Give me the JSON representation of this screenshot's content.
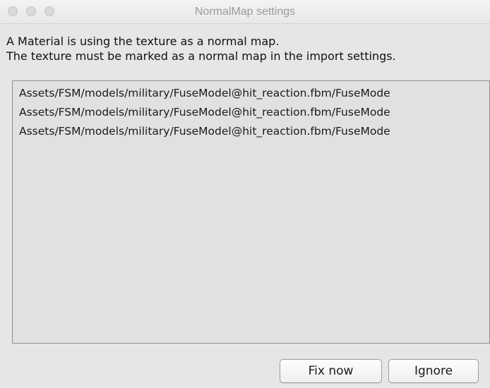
{
  "window": {
    "title": "NormalMap settings"
  },
  "message": {
    "line1": "A Material is using the texture as a normal map.",
    "line2": "The texture must be marked as a normal map in the import settings."
  },
  "asset_list": {
    "items": [
      "Assets/FSM/models/military/FuseModel@hit_reaction.fbm/FuseMode",
      "Assets/FSM/models/military/FuseModel@hit_reaction.fbm/FuseMode",
      "Assets/FSM/models/military/FuseModel@hit_reaction.fbm/FuseMode"
    ]
  },
  "buttons": {
    "fix_label": "Fix now",
    "ignore_label": "Ignore"
  }
}
